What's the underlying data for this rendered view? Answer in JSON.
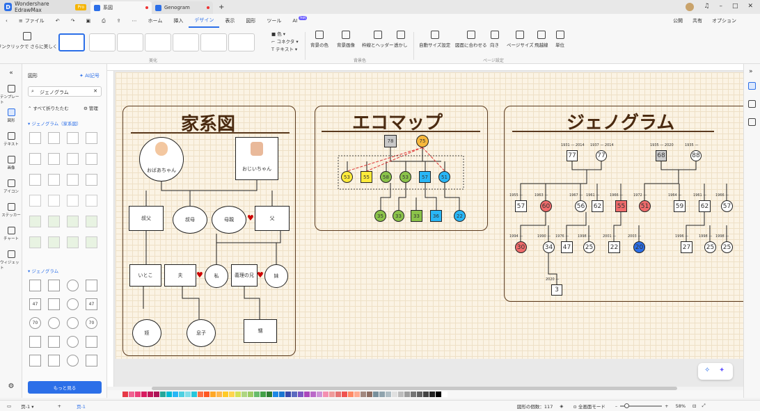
{
  "app": {
    "name": "Wondershare EdrawMax",
    "badge": "Pro"
  },
  "tabs": [
    {
      "label": "系図"
    },
    {
      "label": "Genogram"
    }
  ],
  "menu": {
    "file": "ファイル",
    "items": [
      "ホーム",
      "挿入",
      "デザイン",
      "表示",
      "図形",
      "ツール",
      "AI"
    ],
    "ai_badge": "hot",
    "publish": "公開",
    "share": "共有",
    "options": "オプション"
  },
  "toolbar": {
    "oneclick": "ワンクリックで\nさらに美しく",
    "style_group": "美化",
    "color": "色",
    "connector": "コネクタ",
    "text": "テキスト",
    "bg_group": "背景色",
    "bg_color": "背景の色",
    "bg_image": "背景画像",
    "border_header": "枠線とヘッダー",
    "watermark": "透かし",
    "page_group": "ページ設定",
    "auto_size": "自動サイズ設定",
    "fit_drawing": "図面に合わせる",
    "orientation": "向き",
    "page_size": "ページサイズ",
    "jump": "飛越線",
    "unit": "単位"
  },
  "left_rail": [
    "テンプレート",
    "図形",
    "テキスト",
    "画像",
    "アイコン",
    "ステッカー",
    "チャート",
    "ウィジェット"
  ],
  "panel": {
    "title": "図形",
    "ai": "AI記号",
    "search_value": "ジェノグラム",
    "collapse": "すべて折りたたむ",
    "manage": "管理",
    "lib1": "ジェノグラム（家系図）",
    "lib2": "ジェノグラム",
    "more": "もっと見る",
    "shape_nums": [
      "47",
      "47",
      "70",
      "70"
    ]
  },
  "page": {
    "kakei": {
      "title": "家系図",
      "nodes": {
        "grandma": "おばあちゃん",
        "grandpa": "おじいちゃん",
        "uncle": "叔父",
        "aunt": "叔母",
        "mother": "母親",
        "father": "父",
        "cousin": "いとこ",
        "husband": "夫",
        "me": "私",
        "brother_in_law": "義理の兄",
        "sister": "妹",
        "niece": "姪",
        "son": "息子",
        "nephew": "甥"
      }
    },
    "eco": {
      "title": "エコマップ",
      "top": [
        "78",
        "75"
      ],
      "mid": [
        "53",
        "55",
        "58",
        "53",
        "57",
        "51"
      ],
      "low": [
        "35",
        "33",
        "33",
        "36",
        "22"
      ]
    },
    "geno": {
      "title": "ジェノグラム",
      "g1": [
        "77",
        "77",
        "68",
        "88"
      ],
      "g1_years": [
        "1931 — 2014",
        "1937 — 2014",
        "1935 — 2020",
        "1935 —"
      ],
      "g2": [
        "57",
        "60",
        "56",
        "62",
        "55",
        "51",
        "59",
        "62",
        "57"
      ],
      "g2_years": [
        "1955 —",
        "1963 —",
        "1967 —",
        "1961 —",
        "1966 —",
        "1972 —",
        "1964 —",
        "1961 —",
        "1966 —"
      ],
      "g3": [
        "30",
        "34",
        "47",
        "25",
        "22",
        "20",
        "27",
        "25",
        "25"
      ],
      "g3_years": [
        "1994 —",
        "1990 —",
        "1976 —",
        "1998 —",
        "2001 —",
        "2003 —",
        "1996 —",
        "1998 —",
        "1998 —"
      ],
      "g4": [
        "3"
      ],
      "g4_years": [
        "2020 —"
      ]
    }
  },
  "status": {
    "page_select": "页-1",
    "page_tab": "页-1",
    "shape_count": "図形の個数：117",
    "fullscreen": "全画面モード",
    "zoom": "58%"
  },
  "palette": [
    "#e63946",
    "#f06292",
    "#ec407a",
    "#d81b60",
    "#c2185b",
    "#ad1457",
    "#26a69a",
    "#00bcd4",
    "#29b6f6",
    "#4dd0e1",
    "#80deea",
    "#26c6da",
    "#ff7043",
    "#ff5722",
    "#ffa726",
    "#ffb74d",
    "#ffca28",
    "#ffd54f",
    "#d4e157",
    "#aed581",
    "#9ccc65",
    "#66bb6a",
    "#43a047",
    "#2e7d32",
    "#1e88e5",
    "#1976d2",
    "#3949ab",
    "#5c6bc0",
    "#7e57c2",
    "#ab47bc",
    "#ba68c8",
    "#ce93d8",
    "#f48fb1",
    "#ef9a9a",
    "#e57373",
    "#ef5350",
    "#ff8a65",
    "#ffab91",
    "#a1887f",
    "#8d6e63",
    "#78909c",
    "#90a4ae",
    "#b0bec5",
    "#e0e0e0",
    "#bdbdbd",
    "#9e9e9e",
    "#757575",
    "#616161",
    "#424242",
    "#212121",
    "#000000",
    "#ffffff"
  ]
}
